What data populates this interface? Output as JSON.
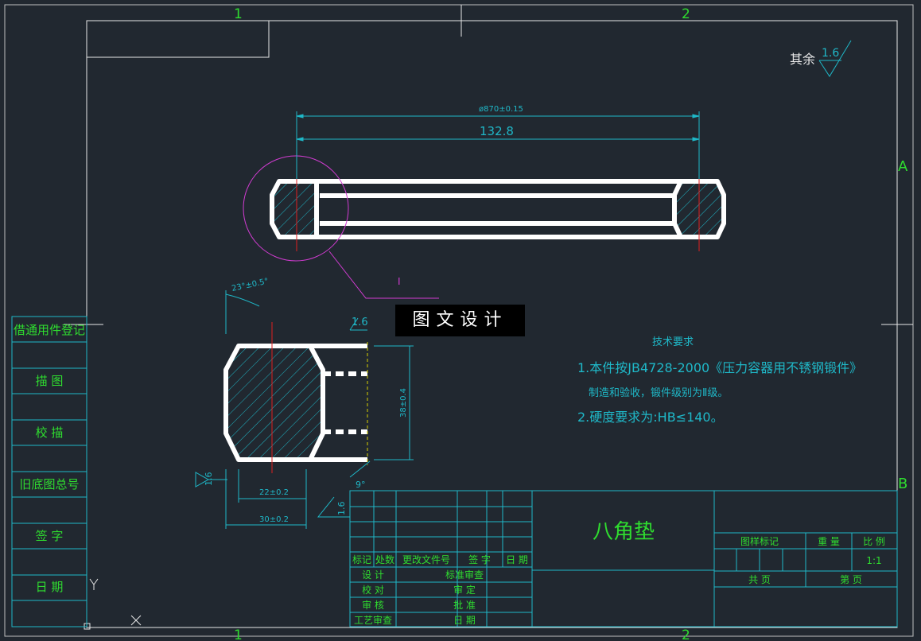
{
  "zones": {
    "top_1": "1",
    "top_2": "2",
    "bottom_1": "1",
    "bottom_2": "2",
    "right_a": "A",
    "right_b": "B"
  },
  "roughness": {
    "label": "其余",
    "value": "1.6",
    "surface_value": "1.6",
    "side_value": "1.6",
    "chamfer_value": "1.6"
  },
  "dims": {
    "outer_dia": "ø870±0.15",
    "pitch": "132.8",
    "angle": "23°±0.5°",
    "height": "38±0.4",
    "width_small": "22±0.2",
    "width_total": "30±0.2",
    "chamfer": "9°",
    "detail_mark": "I"
  },
  "banner": "图文设计",
  "tech_req": {
    "title": "技术要求",
    "line1": "1.本件按JB4728-2000《压力容器用不锈钢锻件》",
    "line2": "制造和验收，锻件级别为Ⅱ级。",
    "line3": "2.硬度要求为:HB≤140。"
  },
  "left_panel": [
    "借通用件登记",
    "描 图",
    "校 描",
    "旧底图总号",
    "签 字",
    "日 期"
  ],
  "title_block": {
    "part_name": "八角垫",
    "rev_headers": [
      "标记",
      "处数",
      "更改文件号",
      "签 字",
      "日 期"
    ],
    "sign_rows": [
      "设 计",
      "校 对",
      "审 核",
      "工艺审查"
    ],
    "sign_rows_right": [
      "标准审查",
      "审 定",
      "批 准",
      "日 期"
    ],
    "info_headers": [
      "图样标记",
      "重 量",
      "比 例"
    ],
    "scale": "1:1",
    "sheet_total": "共  页",
    "sheet_no": "第  页"
  }
}
